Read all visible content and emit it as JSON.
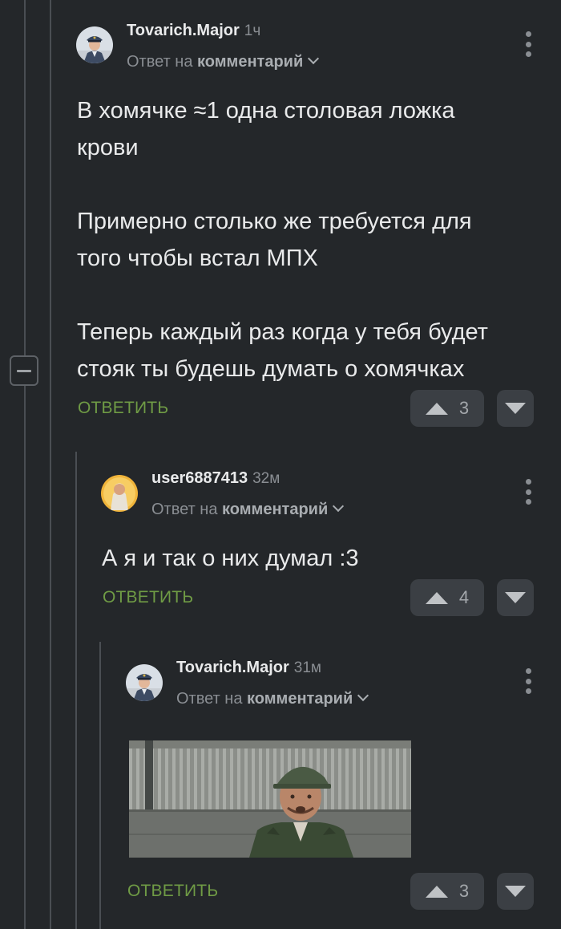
{
  "comments": [
    {
      "username": "Tovarich.Major",
      "time": "1ч",
      "reply_prefix": "Ответ на",
      "reply_target": "комментарий",
      "paragraphs": [
        [
          "В хомячке ≈1 одна столовая ложка",
          "крови"
        ],
        [
          "Примерно столько же требуется для",
          "того чтобы встал МПХ"
        ],
        [
          "Теперь каждый раз когда у тебя будет",
          "стояк ты будешь думать о хомячках"
        ]
      ],
      "reply_label": "ОТВЕТИТЬ",
      "votes": "3"
    },
    {
      "username": "user6887413",
      "time": "32м",
      "reply_prefix": "Ответ на",
      "reply_target": "комментарий",
      "text": "А я и так о них думал :3",
      "reply_label": "ОТВЕТИТЬ",
      "votes": "4"
    },
    {
      "username": "Tovarich.Major",
      "time": "31м",
      "reply_prefix": "Ответ на",
      "reply_target": "комментарий",
      "media": "gif-image",
      "reply_label": "ОТВЕТИТЬ",
      "votes": "3"
    }
  ],
  "colors": {
    "background": "#24272a",
    "accent": "#6f9b45",
    "vote_bg": "#3b3f44"
  }
}
